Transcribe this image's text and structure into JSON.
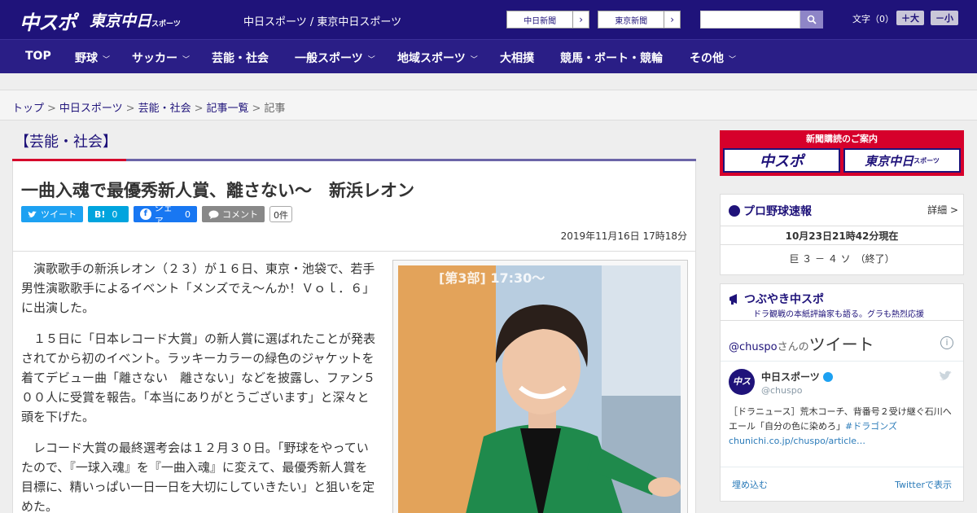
{
  "header": {
    "logo_primary": "中スポ",
    "logo_secondary": "東京中日",
    "logo_secondary_small": "スポーツ",
    "site_title": "中日スポーツ / 東京中日スポーツ",
    "link_chunichi": "中日新聞",
    "link_tokyo": "東京新聞",
    "link_arrow": "›",
    "font_label": "文字（0）",
    "font_larger": "＋大",
    "font_smaller": "－小",
    "accent": "#1f137a"
  },
  "nav": {
    "items": [
      {
        "label": "TOP"
      },
      {
        "label": "野球",
        "chevron": "﹀"
      },
      {
        "label": "サッカー",
        "chevron": "﹀"
      },
      {
        "label": "芸能・社会"
      },
      {
        "label": "一般スポーツ",
        "chevron": "﹀"
      },
      {
        "label": "地域スポーツ",
        "chevron": "﹀"
      },
      {
        "label": "大相撲"
      },
      {
        "label": "競馬・ボート・競輪"
      },
      {
        "label": "その他",
        "chevron": "﹀"
      }
    ]
  },
  "breadcrumb": {
    "items": [
      "トップ",
      "中日スポーツ",
      "芸能・社会",
      "記事一覧",
      "記事"
    ],
    "separator": ">"
  },
  "article": {
    "section": "【芸能・社会】",
    "headline": "一曲入魂で最優秀新人賞、離さない～　新浜レオン",
    "share": {
      "tweet": "ツイート",
      "hatena": "B!",
      "hatena_count": "0",
      "facebook": "シェア",
      "facebook_count": "0",
      "comment": "コメント",
      "comment_count": "0件"
    },
    "date": "2019年11月16日 17時18分",
    "paragraphs": [
      "演歌歌手の新浜レオン（２３）が１６日、東京・池袋で、若手男性演歌歌手によるイベント「メンズでえ～んか！Ｖｏｌ．６」に出演した。",
      "１５日に「日本レコード大賞」の新人賞に選ばれたことが発表されてから初のイベント。ラッキーカラーの緑色のジャケットを着てデビュー曲「離さない　離さない」などを披露し、ファン５００人に受賞を報告。「本当にありがとうございます」と深々と頭を下げた。",
      "レコード大賞の最終選考会は１２月３０日。「野球をやっていたので、『一球入魂』を『一曲入魂』に変えて、最優秀新人賞を目標に、精いっぱい一日一日を大切にしていきたい」と狙いを定めた。"
    ],
    "photo_sign": "[第3部] 17:30～"
  },
  "sidebar": {
    "ad": {
      "title": "新聞購読のご案内",
      "left": "中スポ",
      "right": "東京中日",
      "right_small": "スポーツ"
    },
    "baseball": {
      "title": "プロ野球速報",
      "link": "詳細 >",
      "updated": "10月23日21時42分現在",
      "result": "巨 ３ － ４ ソ　（終了）"
    },
    "tweets": {
      "title": "つぶやき中スポ",
      "subtitle": "ドラ観戦の本紙評論家も語る。グラも熱烈応援",
      "header_handle": "@chuspo",
      "header_san": "さんの",
      "header_tweet": "ツイート",
      "info": "i",
      "account_name": "中日スポーツ",
      "account_handle": "@chuspo",
      "tweet_text": "［ドラニュース］荒木コーチ、背番号２受け継ぐ石川へエール「自分の色に染めろ」",
      "hashtag": "#ドラゴンズ",
      "link": "chunichi.co.jp/chuspo/article…",
      "embed": "埋め込む",
      "view_on": "Twitterで表示"
    }
  }
}
